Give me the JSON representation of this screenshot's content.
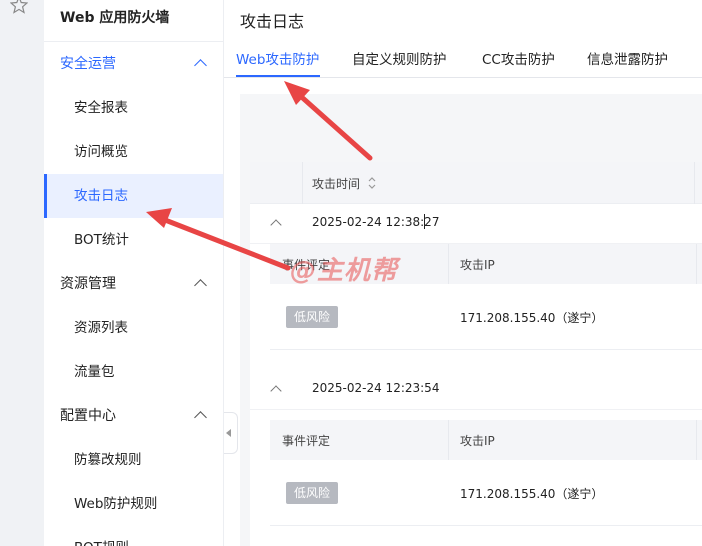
{
  "sidebar": {
    "title": "Web 应用防火墙",
    "groups": [
      {
        "label": "安全运营",
        "items": [
          {
            "label": "安全报表"
          },
          {
            "label": "访问概览"
          },
          {
            "label": "攻击日志"
          },
          {
            "label": "BOT统计"
          }
        ]
      },
      {
        "label": "资源管理",
        "items": [
          {
            "label": "资源列表"
          },
          {
            "label": "流量包"
          }
        ]
      },
      {
        "label": "配置中心",
        "items": [
          {
            "label": "防篡改规则"
          },
          {
            "label": "Web防护规则"
          },
          {
            "label": "BOT规则"
          }
        ]
      }
    ]
  },
  "page": {
    "title": "攻击日志",
    "tabs": [
      {
        "label": "Web攻击防护"
      },
      {
        "label": "自定义规则防护"
      },
      {
        "label": "CC攻击防护"
      },
      {
        "label": "信息泄露防护"
      }
    ]
  },
  "table": {
    "col_time": "攻击时间",
    "rows": [
      {
        "time": "2025-02-24 12:38:27",
        "col_event": "事件评定",
        "col_ip": "攻击IP",
        "risk": "低风险",
        "ip": "171.208.155.40（遂宁）"
      },
      {
        "time": "2025-02-24 12:23:54",
        "col_event": "事件评定",
        "col_ip": "攻击IP",
        "risk": "低风险",
        "ip": "171.208.155.40（遂宁）"
      }
    ]
  },
  "watermark": "@主机帮",
  "colors": {
    "accent": "#2c68ff",
    "arrow": "#e84545",
    "badge": "#b6b9c0"
  }
}
